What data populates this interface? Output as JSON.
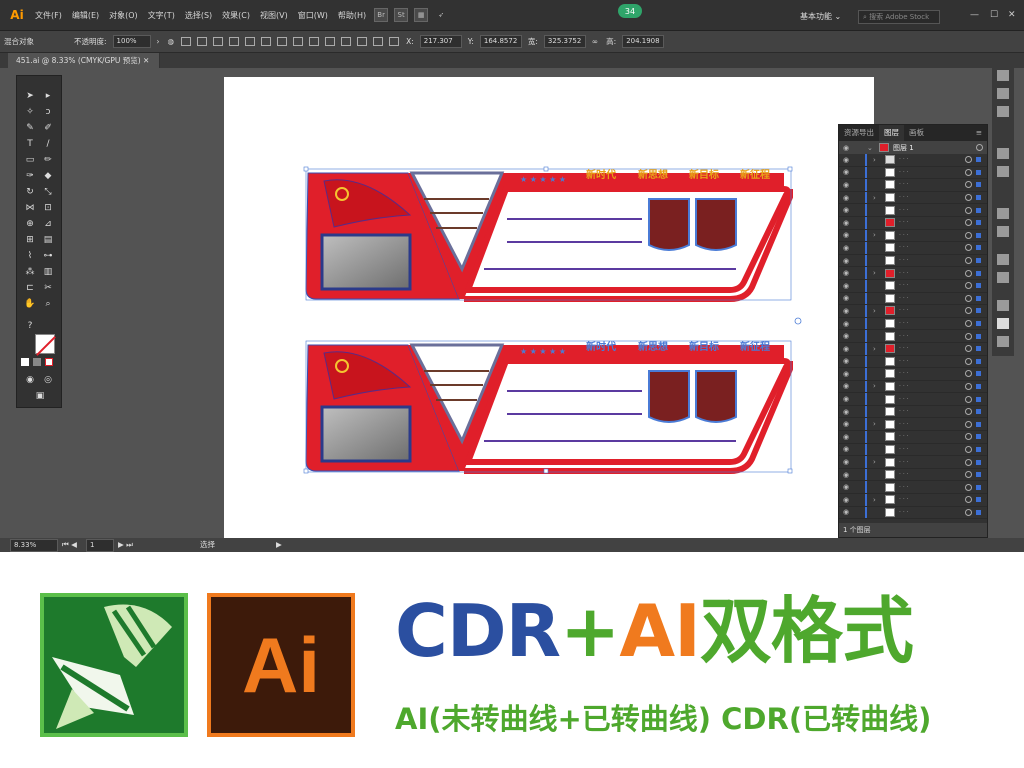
{
  "app": {
    "logo": "Ai",
    "menus": [
      "文件(F)",
      "编辑(E)",
      "对象(O)",
      "文字(T)",
      "选择(S)",
      "效果(C)",
      "视图(V)",
      "窗口(W)",
      "帮助(H)"
    ],
    "badge": "34",
    "workspace": "基本功能",
    "search_placeholder": "搜索 Adobe Stock"
  },
  "control_bar": {
    "object_type": "混合对象",
    "opacity_label": "不透明度:",
    "opacity_value": "100%",
    "x_label": "X:",
    "x_value": "217.307",
    "y_label": "Y:",
    "y_value": "164.8572",
    "w_label": "宽:",
    "w_value": "325.3752",
    "h_label": "高:",
    "h_value": "204.1908"
  },
  "document": {
    "tab_title": "451.ai @ 8.33% (CMYK/GPU 预览)"
  },
  "artwork": {
    "slogans": [
      "新时代",
      "新思想",
      "新目标",
      "新征程"
    ],
    "brand_red": "#e01f2a",
    "inner_dark": "#b8141d",
    "photo_frame": "#2b3a8a",
    "shield_fill": "#7a2020"
  },
  "layers_panel": {
    "tabs": [
      "资源导出",
      "图层",
      "画板"
    ],
    "layer_name": "图层 1",
    "footer": "1 个图层"
  },
  "status_bar": {
    "zoom": "8.33%",
    "artboard": "1",
    "tool": "选择"
  },
  "promo": {
    "ai_logo_text": "Ai",
    "title_cdr": "CDR",
    "title_plus": "+",
    "title_ai": "AI",
    "title_format": "双格式",
    "subtitle": "AI(未转曲线+已转曲线) CDR(已转曲线)",
    "color_blue": "#2b4fa0",
    "color_green": "#4ea82d",
    "color_orange": "#f07a1e"
  }
}
